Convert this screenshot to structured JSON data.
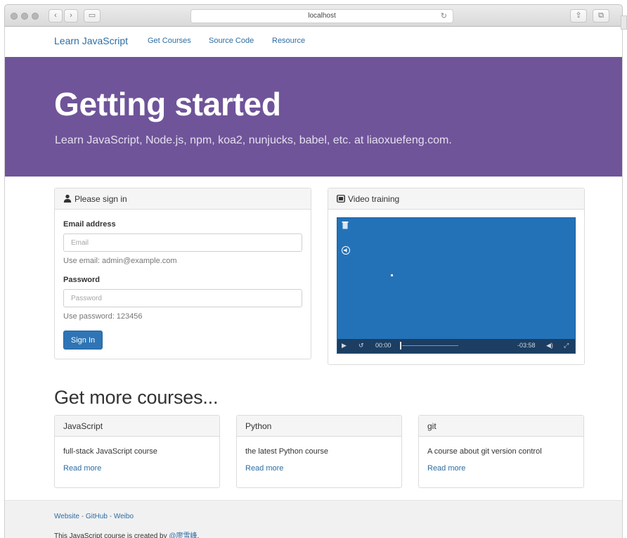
{
  "browser": {
    "url": "localhost",
    "back_glyph": "‹",
    "forward_glyph": "›",
    "sidebar_glyph": "▭",
    "reload_glyph": "↻",
    "share_glyph": "⇪",
    "tabs_glyph": "⧉"
  },
  "navbar": {
    "brand": "Learn JavaScript",
    "links": [
      "Get Courses",
      "Source Code",
      "Resource"
    ]
  },
  "hero": {
    "title": "Getting started",
    "subtitle": "Learn JavaScript, Node.js, npm, koa2, nunjucks, babel, etc. at liaoxuefeng.com."
  },
  "signin": {
    "heading": "Please sign in",
    "email_label": "Email address",
    "email_placeholder": "Email",
    "email_help": "Use email: admin@example.com",
    "password_label": "Password",
    "password_placeholder": "Password",
    "password_help": "Use password: 123456",
    "button": "Sign In",
    "icon": "user-icon"
  },
  "video": {
    "heading": "Video training",
    "icon": "film-icon",
    "current_time": "00:00",
    "remaining_time": "-03:58",
    "play_glyph": "▶",
    "replay_glyph": "↺",
    "volume_glyph": "◀)",
    "fullscreen_glyph": "⤢"
  },
  "courses": {
    "heading": "Get more courses...",
    "items": [
      {
        "title": "JavaScript",
        "desc": "full-stack JavaScript course",
        "link": "Read more"
      },
      {
        "title": "Python",
        "desc": "the latest Python course",
        "link": "Read more"
      },
      {
        "title": "git",
        "desc": "A course about git version control",
        "link": "Read more"
      }
    ]
  },
  "footer": {
    "link_website": "Website",
    "link_github": "GitHub",
    "link_weibo": "Weibo",
    "separator": " - ",
    "credit_prefix": "This JavaScript course is created by ",
    "credit_author": "@廖雪峰",
    "credit_suffix": "."
  },
  "colors": {
    "hero_bg": "#6f5499",
    "link": "#2d6da3",
    "primary_button": "#2f75b5",
    "video_bg": "#2372b8"
  }
}
